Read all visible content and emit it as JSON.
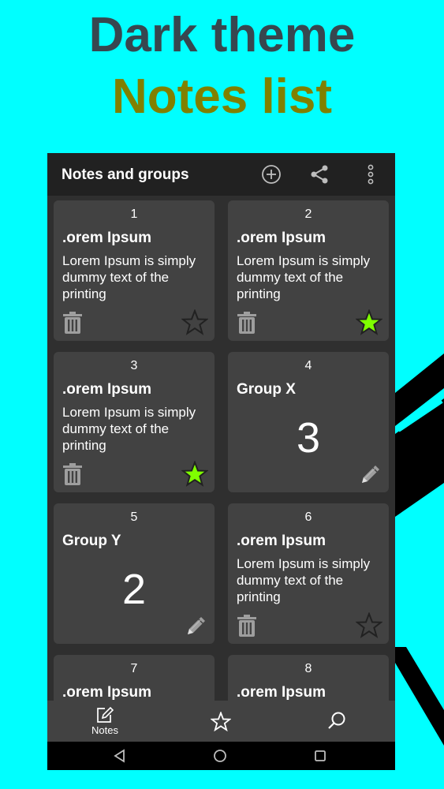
{
  "headline": {
    "line1": "Dark theme",
    "line2": "Notes list"
  },
  "colors": {
    "background": "#00ffff",
    "headline1": "#37474f",
    "headline2": "#808000",
    "card": "#424242",
    "appbar": "#212121",
    "star_active": "#7fff00"
  },
  "appbar": {
    "title": "Notes and groups",
    "actions": [
      "add-circle-icon",
      "share-icon",
      "more-vert-icon"
    ]
  },
  "cards": [
    {
      "number": "1",
      "title": ".orem Ipsum",
      "body": "Lorem Ipsum is simply dummy text of the printing",
      "type": "note",
      "starred": false
    },
    {
      "number": "2",
      "title": ".orem Ipsum",
      "body": "Lorem Ipsum is simply dummy text of the printing",
      "type": "note",
      "starred": true
    },
    {
      "number": "3",
      "title": ".orem Ipsum",
      "body": "Lorem Ipsum is simply dummy text of the printing",
      "type": "note",
      "starred": true
    },
    {
      "number": "4",
      "title": "Group X",
      "count": "3",
      "type": "group"
    },
    {
      "number": "5",
      "title": "Group Y",
      "count": "2",
      "type": "group"
    },
    {
      "number": "6",
      "title": ".orem Ipsum",
      "body": "Lorem Ipsum is simply dummy text of the printing",
      "type": "note",
      "starred": false
    },
    {
      "number": "7",
      "title": ".orem Ipsum",
      "type": "note"
    },
    {
      "number": "8",
      "title": ".orem Ipsum",
      "type": "note"
    }
  ],
  "bottom_nav": {
    "notes_label": "Notes",
    "items": [
      "edit-note-icon",
      "star-icon",
      "search-icon"
    ]
  },
  "system_nav": [
    "back-icon",
    "home-icon",
    "recents-icon"
  ]
}
